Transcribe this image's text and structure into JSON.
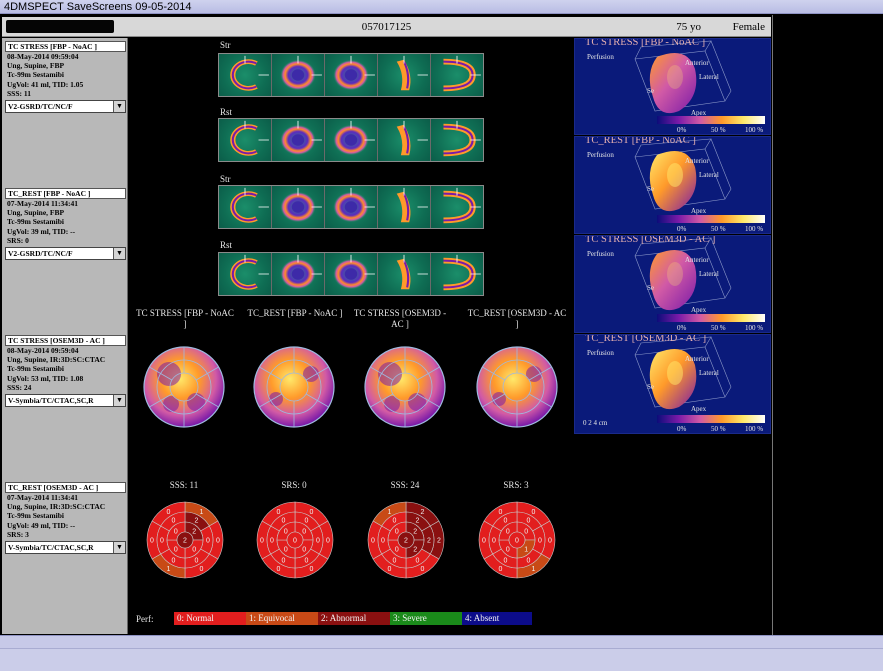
{
  "window": {
    "title": "4DMSPECT SaveScreens 09-05-2014"
  },
  "header": {
    "patient_id": "057017125",
    "age": "75 yo",
    "sex": "Female"
  },
  "sidebar": {
    "cards": [
      {
        "label": "TC STRESS [FBP - NoAC ]",
        "lines": [
          "08-May-2014 09:59:04",
          "Ung, Supine, FBP",
          "Tc-99m Sestamibi",
          "UgVol: 41 ml,   TID: 1.05",
          "SSS: 11"
        ],
        "select": "V2-GSRD/TC/NC/F"
      },
      {
        "label": "TC_REST [FBP - NoAC ]",
        "lines": [
          "07-May-2014 11:34:41",
          "Ung, Supine, FBP",
          "Tc-99m Sestamibi",
          "UgVol: 39 ml,   TID: --",
          "SRS: 0"
        ],
        "select": "V2-GSRD/TC/NC/F"
      },
      {
        "label": "TC STRESS [OSEM3D - AC ]",
        "lines": [
          "08-May-2014 09:59:04",
          "Ung, Supine, IR:3D:SC:CTAC",
          "Tc-99m Sestamibi",
          "UgVol: 53 ml,   TID: 1.08",
          "SSS: 24"
        ],
        "select": "V-Symbia/TC/CTAC,SC,R"
      },
      {
        "label": "TC_REST [OSEM3D - AC ]",
        "lines": [
          "07-May-2014 11:34:41",
          "Ung, Supine, IR:3D:SC:CTAC",
          "Tc-99m Sestamibi",
          "UgVol: 49 ml,   TID: --",
          "SRS: 3"
        ],
        "select": "V-Symbia/TC/CTAC,SC,R"
      }
    ]
  },
  "slices": {
    "rows": [
      {
        "label": "Str"
      },
      {
        "label": "Rst"
      },
      {
        "label": "Str"
      },
      {
        "label": "Rst"
      }
    ]
  },
  "polar": {
    "titles": [
      "TC STRESS [FBP - NoAC ]",
      "TC_REST [FBP - NoAC ]",
      "TC STRESS [OSEM3D - AC ]",
      "TC_REST [OSEM3D - AC ]"
    ],
    "scores": [
      "SSS: 11",
      "SRS: 0",
      "SSS: 24",
      "SRS: 3"
    ]
  },
  "legend": {
    "label": "Perf:",
    "items": [
      {
        "text": "0: Normal",
        "color": "#e21e1e"
      },
      {
        "text": "1: Equivocal",
        "color": "#c84a16"
      },
      {
        "text": "2: Abnormal",
        "color": "#8a1010"
      },
      {
        "text": "3: Severe",
        "color": "#1a8a1a"
      },
      {
        "text": "4: Absent",
        "color": "#0c0c8a"
      }
    ]
  },
  "panels3d": [
    {
      "title": "TC STRESS [FBP - NoAC ]",
      "perfusion": "Perfusion",
      "anterior": "Anterior",
      "lateral": "Lateral",
      "sep": "Se",
      "apex": "Apex",
      "ticks": [
        "0%",
        "50 %",
        "100 %"
      ]
    },
    {
      "title": "TC_REST [FBP - NoAC ]",
      "perfusion": "Perfusion",
      "anterior": "Anterior",
      "lateral": "Lateral",
      "sep": "Se",
      "apex": "Apex",
      "ticks": [
        "0%",
        "50 %",
        "100 %"
      ]
    },
    {
      "title": "TC STRESS [OSEM3D - AC ]",
      "perfusion": "Perfusion",
      "anterior": "Anterior",
      "lateral": "Lateral",
      "sep": "Se",
      "apex": "Apex",
      "ticks": [
        "0%",
        "50 %",
        "100 %"
      ]
    },
    {
      "title": "TC_REST [OSEM3D - AC ]",
      "perfusion": "Perfusion",
      "anterior": "Anterior",
      "lateral": "Lateral",
      "sep": "Se",
      "apex": "Apex",
      "ticks": [
        "0%",
        "50 %",
        "100 %"
      ],
      "scale": "0   2   4 cm"
    }
  ],
  "colors": {
    "title_bar": "#c4c6ea",
    "panel_blue": "#0a1a7a",
    "tissue_green": "#1b8e6a"
  }
}
